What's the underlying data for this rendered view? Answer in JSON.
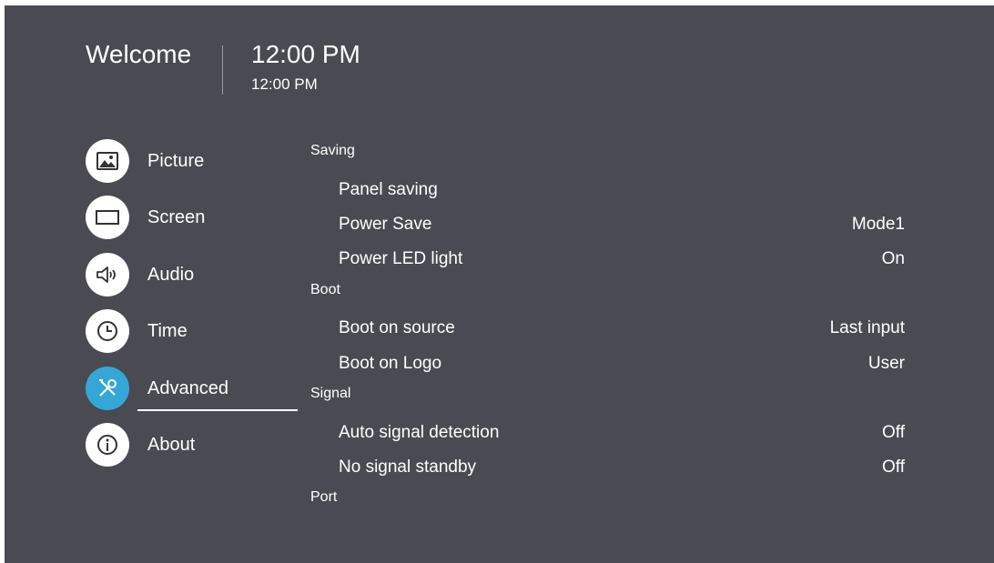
{
  "header": {
    "title": "Welcome",
    "time": "12:00 PM",
    "time_sub": "12:00 PM"
  },
  "sidebar": {
    "items": [
      {
        "label": "Picture",
        "icon": "picture-icon"
      },
      {
        "label": "Screen",
        "icon": "screen-icon"
      },
      {
        "label": "Audio",
        "icon": "audio-icon"
      },
      {
        "label": "Time",
        "icon": "clock-icon"
      },
      {
        "label": "Advanced",
        "icon": "tools-icon",
        "active": true
      },
      {
        "label": "About",
        "icon": "info-icon"
      }
    ]
  },
  "colors": {
    "background": "#4a4a52",
    "accent": "#35a7d6"
  },
  "main": {
    "sections": [
      {
        "header": "Saving",
        "rows": [
          {
            "label": "Panel saving",
            "value": ""
          },
          {
            "label": "Power Save",
            "value": "Mode1"
          },
          {
            "label": "Power LED light",
            "value": "On"
          }
        ]
      },
      {
        "header": "Boot",
        "rows": [
          {
            "label": "Boot on source",
            "value": "Last input"
          },
          {
            "label": "Boot on Logo",
            "value": "User"
          }
        ]
      },
      {
        "header": "Signal",
        "rows": [
          {
            "label": "Auto signal detection",
            "value": "Off"
          },
          {
            "label": "No signal standby",
            "value": "Off"
          }
        ]
      },
      {
        "header": "Port",
        "rows": []
      }
    ]
  }
}
